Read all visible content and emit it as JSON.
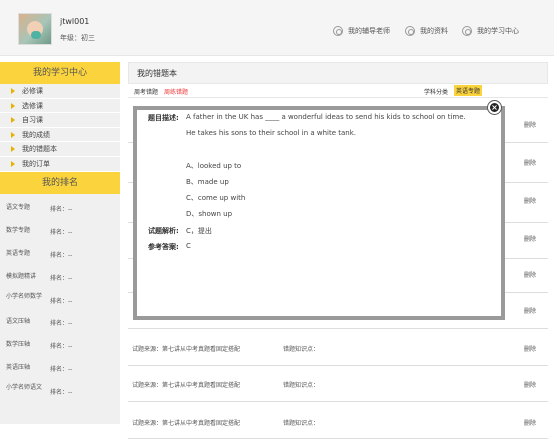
{
  "header": {
    "username": "jtwl001",
    "grade": "年级：初三",
    "nav": [
      "我的辅导老师",
      "我的资料",
      "我的学习中心"
    ]
  },
  "sidebar": {
    "title": "我的学习中心",
    "items": [
      "必修课",
      "选修课",
      "自习课",
      "我的成绩",
      "我的错题本",
      "我的订单"
    ],
    "rank_title": "我的排名",
    "ranks": [
      {
        "subject": "语文专题",
        "rank": "排名：--"
      },
      {
        "subject": "数学专题",
        "rank": "排名：--"
      },
      {
        "subject": "英语专题",
        "rank": "排名：--"
      },
      {
        "subject": "模拟题精讲",
        "rank": "排名：--"
      },
      {
        "subject": "小学名师数学",
        "rank": "排名：--"
      },
      {
        "subject": "语文压轴",
        "rank": "排名：--"
      },
      {
        "subject": "数学压轴",
        "rank": "排名：--"
      },
      {
        "subject": "英语压轴",
        "rank": "排名：--"
      },
      {
        "subject": "小学名师语文",
        "rank": "排名：--"
      }
    ]
  },
  "main": {
    "title": "我的错题本",
    "tabs": [
      "周考错题",
      "周练错题"
    ],
    "subject_label": "学科分类",
    "subject_tag": "英语专题",
    "delete_label": "删除",
    "rows": [
      {
        "source": "试题来源：第七讲从中考真题看固定搭配",
        "knowledge": "错题知识点："
      },
      {
        "source": "试题来源：第七讲从中考真题看固定搭配",
        "knowledge": "错题知识点："
      },
      {
        "source": "试题来源：第七讲从中考真题看固定搭配",
        "knowledge": "错题知识点："
      }
    ]
  },
  "modal": {
    "desc_label": "题目描述:",
    "question_line1": "A father in the UK has ____ a wonderful ideas to send his kids to school on time.",
    "question_line2": "He takes his sons to their school in a white tank.",
    "options": [
      "A、looked up to",
      "B、made up",
      "C、come up with",
      "D、shown up"
    ],
    "analysis_label": "试题解析:",
    "analysis": "C，提出",
    "answer_label": "参考答案:",
    "answer": "C",
    "close": "×"
  }
}
